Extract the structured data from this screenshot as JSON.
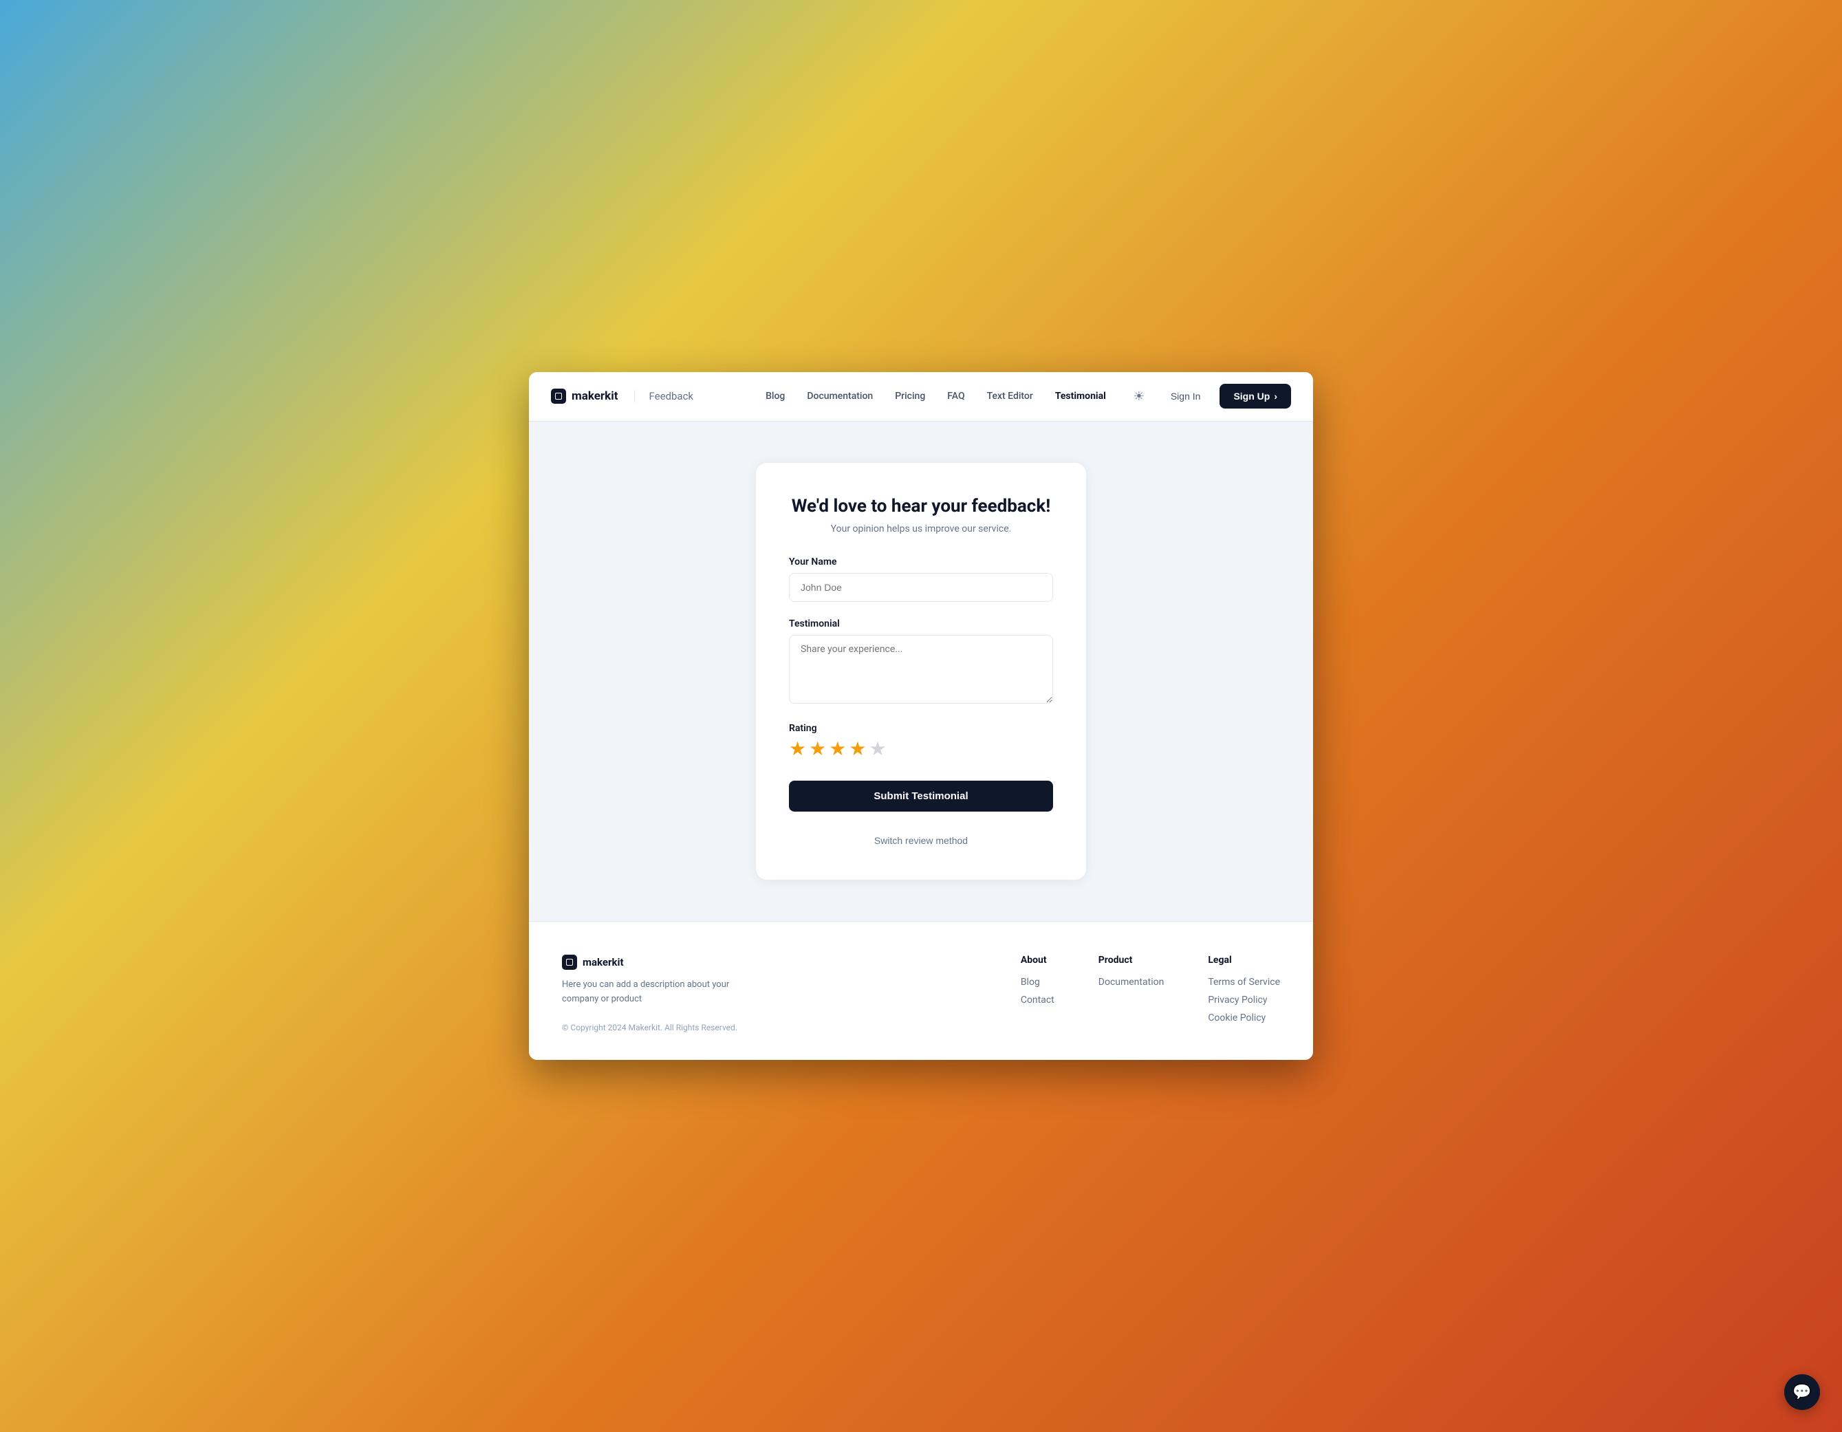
{
  "browser": {
    "background": "linear-gradient(135deg, #4aa8d8 0%, #e8c840 30%, #e07820 60%, #c84020 100%)"
  },
  "navbar": {
    "logo": "makerkit",
    "current_page": "Feedback",
    "links": [
      {
        "label": "Blog",
        "active": false
      },
      {
        "label": "Documentation",
        "active": false
      },
      {
        "label": "Pricing",
        "active": false
      },
      {
        "label": "FAQ",
        "active": false
      },
      {
        "label": "Text Editor",
        "active": false
      },
      {
        "label": "Testimonial",
        "active": true
      }
    ],
    "sign_in": "Sign In",
    "sign_up": "Sign Up"
  },
  "feedback_form": {
    "title": "We'd love to hear your feedback!",
    "subtitle": "Your opinion helps us improve our service.",
    "name_label": "Your Name",
    "name_placeholder": "John Doe",
    "testimonial_label": "Testimonial",
    "testimonial_placeholder": "Share your experience...",
    "rating_label": "Rating",
    "stars_filled": 4,
    "stars_total": 5,
    "submit_label": "Submit Testimonial",
    "switch_label": "Switch review method"
  },
  "footer": {
    "logo": "makerkit",
    "description": "Here you can add a description about your company or product",
    "copyright": "© Copyright 2024 Makerkit. All Rights Reserved.",
    "columns": [
      {
        "title": "About",
        "links": [
          "Blog",
          "Contact"
        ]
      },
      {
        "title": "Product",
        "links": [
          "Documentation"
        ]
      },
      {
        "title": "Legal",
        "links": [
          "Terms of Service",
          "Privacy Policy",
          "Cookie Policy"
        ]
      }
    ]
  }
}
